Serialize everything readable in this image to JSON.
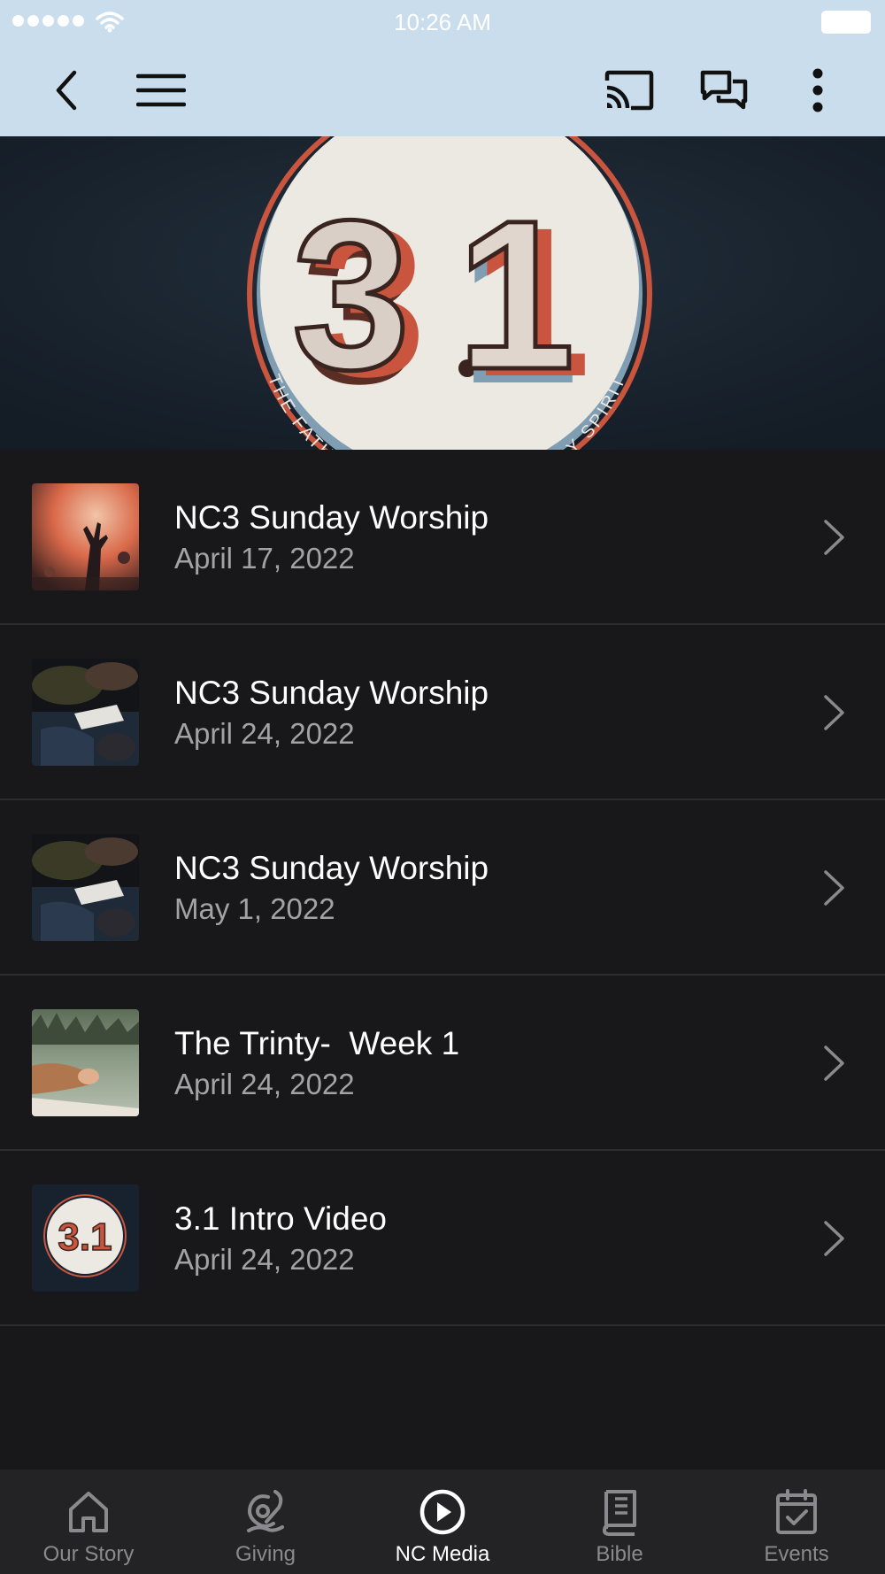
{
  "status_bar": {
    "time": "10:26 AM"
  },
  "nav_bar": {
    "icons": [
      "back-icon",
      "menu-icon",
      "cast-icon",
      "chat-icon",
      "more-vertical-icon"
    ]
  },
  "banner": {
    "logo_text": "3.1",
    "ring_text": "THE FATHER, THE SON & THE HOLY SPIRIT",
    "colors": {
      "background": "#1a2430",
      "circle": "#ece8e2",
      "ring": "#c9553e",
      "shadow_blue": "#7f9db3"
    }
  },
  "media_list": [
    {
      "title": "NC3 Sunday Worship",
      "date": "April 17, 2022",
      "thumbnail": "worship-hands"
    },
    {
      "title": "NC3 Sunday Worship",
      "date": "April 24, 2022",
      "thumbnail": "congregation-bible"
    },
    {
      "title": "NC3 Sunday Worship",
      "date": "May 1, 2022",
      "thumbnail": "congregation-bible"
    },
    {
      "title": "The Trinty-  Week 1",
      "date": "April 24, 2022",
      "thumbnail": "prayer-lake"
    },
    {
      "title": "3.1 Intro Video",
      "date": "April 24, 2022",
      "thumbnail": "logo-3-1",
      "thumb_logo": "3.1"
    }
  ],
  "tab_bar": {
    "active_tab": "NC Media",
    "tabs": [
      {
        "label": "Our Story",
        "icon": "home-icon"
      },
      {
        "label": "Giving",
        "icon": "giving-icon"
      },
      {
        "label": "NC Media",
        "icon": "play-circle-icon"
      },
      {
        "label": "Bible",
        "icon": "bible-icon"
      },
      {
        "label": "Events",
        "icon": "calendar-check-icon"
      }
    ]
  },
  "colors": {
    "header_background": "#c9ddec",
    "list_background": "#18181a",
    "tab_bar_background": "#232325",
    "title_text": "#ffffff",
    "date_text": "#a3a3a6",
    "tab_inactive": "#8a8a8e"
  }
}
